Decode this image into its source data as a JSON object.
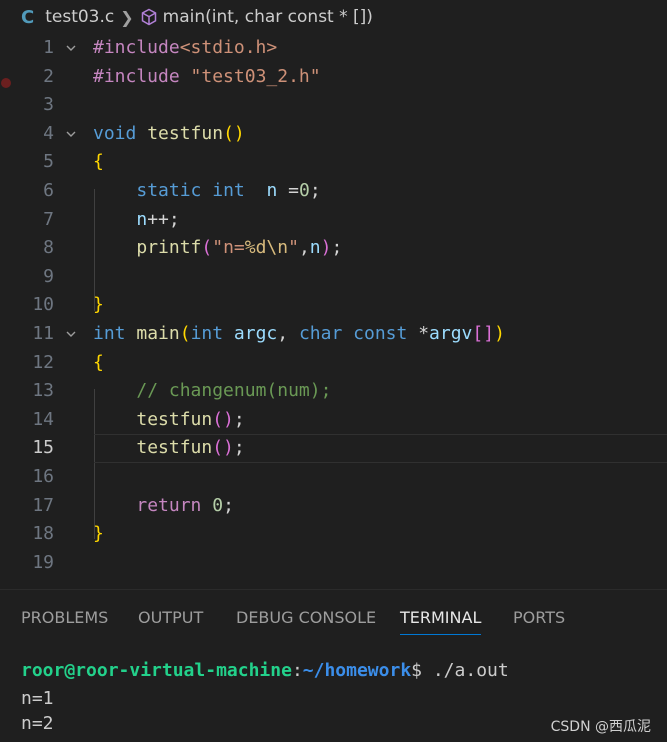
{
  "breadcrumb": {
    "file_icon": "C",
    "file": "test03.c",
    "symbol": "main(int, char const * [])"
  },
  "code_lines": [
    {
      "n": "1",
      "fold": true,
      "tokens": [
        [
          "pp",
          "#include"
        ],
        [
          "str",
          "<stdio.h>"
        ]
      ]
    },
    {
      "n": "2",
      "fold": false,
      "tokens": [
        [
          "pp",
          "#include "
        ],
        [
          "str",
          "\"test03_2.h\""
        ]
      ]
    },
    {
      "n": "3",
      "fold": false,
      "tokens": []
    },
    {
      "n": "4",
      "fold": true,
      "tokens": [
        [
          "kw",
          "void"
        ],
        [
          "op",
          " "
        ],
        [
          "fn",
          "testfun"
        ],
        [
          "b1",
          "()"
        ]
      ]
    },
    {
      "n": "5",
      "fold": false,
      "tokens": [
        [
          "b1",
          "{"
        ]
      ]
    },
    {
      "n": "6",
      "fold": false,
      "tokens": [
        [
          "op",
          "    "
        ],
        [
          "kw",
          "static"
        ],
        [
          "op",
          " "
        ],
        [
          "kw",
          "int"
        ],
        [
          "op",
          "  "
        ],
        [
          "var",
          "n"
        ],
        [
          "op",
          " ="
        ],
        [
          "num",
          "0"
        ],
        [
          "op",
          ";"
        ]
      ]
    },
    {
      "n": "7",
      "fold": false,
      "tokens": [
        [
          "op",
          "    "
        ],
        [
          "var",
          "n"
        ],
        [
          "op",
          "++;"
        ]
      ]
    },
    {
      "n": "8",
      "fold": false,
      "tokens": [
        [
          "op",
          "    "
        ],
        [
          "fn",
          "printf"
        ],
        [
          "b2",
          "("
        ],
        [
          "str",
          "\"n="
        ],
        [
          "esc",
          "%d\\n"
        ],
        [
          "str",
          "\""
        ],
        [
          "op",
          ","
        ],
        [
          "var",
          "n"
        ],
        [
          "b2",
          ")"
        ],
        [
          "op",
          ";"
        ]
      ]
    },
    {
      "n": "9",
      "fold": false,
      "tokens": []
    },
    {
      "n": "10",
      "fold": false,
      "tokens": [
        [
          "b1",
          "}"
        ]
      ]
    },
    {
      "n": "11",
      "fold": true,
      "tokens": [
        [
          "kw",
          "int"
        ],
        [
          "op",
          " "
        ],
        [
          "fn",
          "main"
        ],
        [
          "b1",
          "("
        ],
        [
          "kw",
          "int"
        ],
        [
          "op",
          " "
        ],
        [
          "var",
          "argc"
        ],
        [
          "op",
          ", "
        ],
        [
          "kw",
          "char"
        ],
        [
          "op",
          " "
        ],
        [
          "kw",
          "const"
        ],
        [
          "op",
          " *"
        ],
        [
          "var",
          "argv"
        ],
        [
          "b2",
          "[]"
        ],
        [
          "b1",
          ")"
        ]
      ]
    },
    {
      "n": "12",
      "fold": false,
      "tokens": [
        [
          "b1",
          "{"
        ]
      ]
    },
    {
      "n": "13",
      "fold": false,
      "tokens": [
        [
          "op",
          "    "
        ],
        [
          "cmt",
          "// changenum(num);"
        ]
      ]
    },
    {
      "n": "14",
      "fold": false,
      "tokens": [
        [
          "op",
          "    "
        ],
        [
          "fn",
          "testfun"
        ],
        [
          "b2",
          "()"
        ],
        [
          "op",
          ";"
        ]
      ]
    },
    {
      "n": "15",
      "fold": false,
      "current": true,
      "tokens": [
        [
          "op",
          "    "
        ],
        [
          "fn",
          "testfun"
        ],
        [
          "b2",
          "()"
        ],
        [
          "op",
          ";"
        ]
      ]
    },
    {
      "n": "16",
      "fold": false,
      "tokens": []
    },
    {
      "n": "17",
      "fold": false,
      "tokens": [
        [
          "op",
          "    "
        ],
        [
          "ctl",
          "return"
        ],
        [
          "op",
          " "
        ],
        [
          "num",
          "0"
        ],
        [
          "op",
          ";"
        ]
      ]
    },
    {
      "n": "18",
      "fold": false,
      "tokens": [
        [
          "b1",
          "}"
        ]
      ]
    },
    {
      "n": "19",
      "fold": false,
      "tokens": []
    }
  ],
  "panel": {
    "tabs": [
      {
        "id": "problems",
        "label": "PROBLEMS",
        "active": false
      },
      {
        "id": "output",
        "label": "OUTPUT",
        "active": false
      },
      {
        "id": "debug-console",
        "label": "DEBUG CONSOLE",
        "active": false
      },
      {
        "id": "terminal",
        "label": "TERMINAL",
        "active": true
      },
      {
        "id": "ports",
        "label": "PORTS",
        "active": false
      }
    ]
  },
  "terminal": {
    "prompt_user": "roor@roor-virtual-machine",
    "prompt_sep": ":",
    "prompt_path": "~/homework",
    "prompt_end": "$ ",
    "command": "./a.out",
    "output": [
      "n=1",
      "n=2"
    ]
  },
  "watermark": "CSDN @西瓜泥",
  "colors": {
    "background": "#1f1f1f",
    "accent": "#0078d4",
    "terminal_user": "#23d18b",
    "terminal_path": "#3b8eea"
  }
}
